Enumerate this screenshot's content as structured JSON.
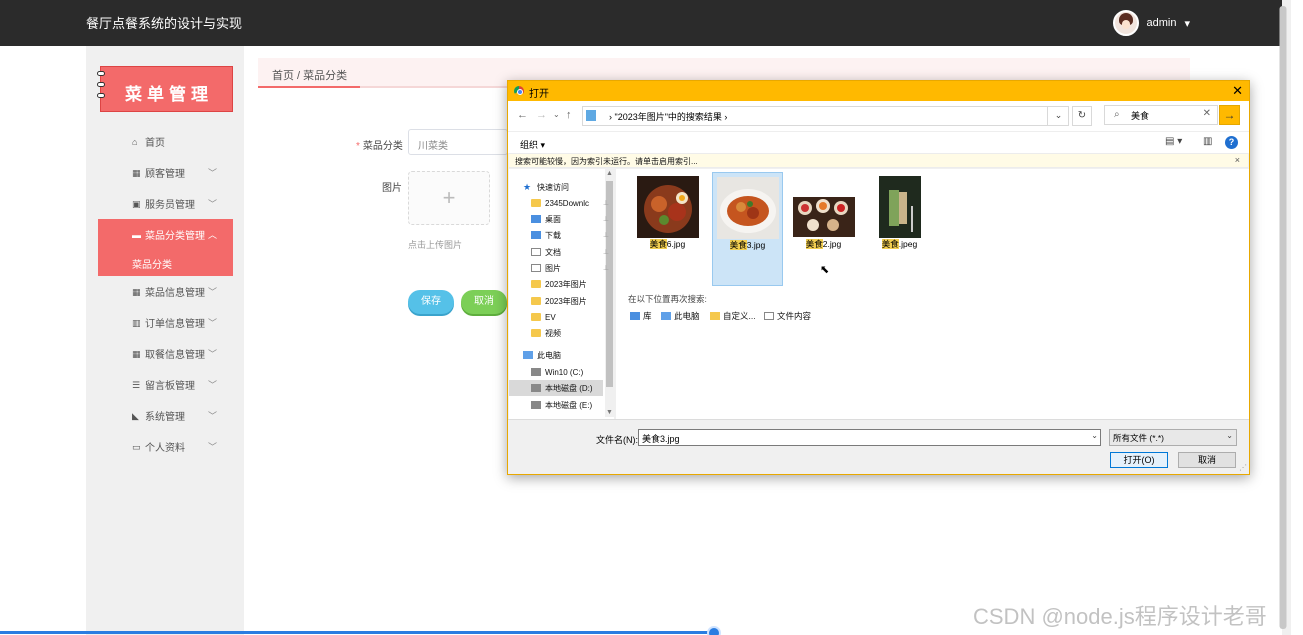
{
  "header": {
    "title": "餐厅点餐系统的设计与实现",
    "user": "admin",
    "caret": "▾"
  },
  "sidebar": {
    "logo": "菜单管理",
    "items": [
      {
        "label": "首页",
        "icon": "⌂",
        "chev": ""
      },
      {
        "label": "顾客管理",
        "icon": "▦",
        "chev": "﹀"
      },
      {
        "label": "服务员管理",
        "icon": "▣",
        "chev": "﹀"
      },
      {
        "label": "菜品分类管理",
        "icon": "▬",
        "chev": "︿"
      },
      {
        "label": "菜品信息管理",
        "icon": "▦",
        "chev": "﹀"
      },
      {
        "label": "订单信息管理",
        "icon": "▥",
        "chev": "﹀"
      },
      {
        "label": "取餐信息管理",
        "icon": "▦",
        "chev": "﹀"
      },
      {
        "label": "留言板管理",
        "icon": "☰",
        "chev": "﹀"
      },
      {
        "label": "系统管理",
        "icon": "◣",
        "chev": "﹀"
      },
      {
        "label": "个人资料",
        "icon": "▭",
        "chev": "﹀"
      }
    ],
    "active_sub": "菜品分类"
  },
  "breadcrumb": "首页 / 菜品分类",
  "form": {
    "category_label": "菜品分类",
    "category_value": "川菜类",
    "image_label": "图片",
    "upload_plus": "+",
    "upload_hint": "点击上传图片",
    "save": "保存",
    "cancel": "取消"
  },
  "dialog": {
    "title": "打开",
    "close": "✕",
    "nav": {
      "back": "←",
      "forward": "→",
      "recent": "⌄",
      "up": "↑"
    },
    "path": "› \"2023年图片\"中的搜索结果 ›",
    "path_dd": "⌄",
    "refresh": "↻",
    "search_icon": "⌕",
    "search_value": "美食",
    "search_clear": "✕",
    "go": "→",
    "organize": "组织 ▾",
    "view_icon": "▤ ▾",
    "pane_icon": "▥",
    "help": "?",
    "info": "搜索可能较慢，因为索引未运行。请单击启用索引...",
    "info_close": "×",
    "nav_items": [
      {
        "label": "快速访问",
        "type": "star",
        "pin": ""
      },
      {
        "label": "2345Downlc",
        "type": "folder",
        "pin": "📌"
      },
      {
        "label": "桌面",
        "type": "blue",
        "pin": "📌"
      },
      {
        "label": "下载",
        "type": "blue",
        "pin": "📌"
      },
      {
        "label": "文档",
        "type": "doc",
        "pin": "📌"
      },
      {
        "label": "图片",
        "type": "doc",
        "pin": "📌"
      },
      {
        "label": "2023年图片",
        "type": "folder",
        "pin": ""
      },
      {
        "label": "2023年图片",
        "type": "folder",
        "pin": ""
      },
      {
        "label": "EV",
        "type": "folder",
        "pin": ""
      },
      {
        "label": "视频",
        "type": "folder",
        "pin": ""
      },
      {
        "label": "此电脑",
        "type": "pc",
        "pin": ""
      },
      {
        "label": "Win10 (C:)",
        "type": "drive",
        "pin": ""
      },
      {
        "label": "本地磁盘 (D:)",
        "type": "drive",
        "pin": ""
      },
      {
        "label": "本地磁盘 (E:)",
        "type": "drive",
        "pin": ""
      }
    ],
    "files": [
      {
        "hl": "美食",
        "rest": "6.jpg"
      },
      {
        "hl": "美食",
        "rest": "3.jpg"
      },
      {
        "hl": "美食",
        "rest": "2.jpg"
      },
      {
        "hl": "美食",
        "rest": ".jpeg"
      }
    ],
    "search_again": "在以下位置再次搜索:",
    "locations": [
      "库",
      "此电脑",
      "自定义...",
      "文件内容"
    ],
    "filename_label": "文件名(N):",
    "filename_value": "美食3.jpg",
    "filetype_value": "所有文件 (*.*)",
    "open": "打开(O)",
    "cancel": "取消"
  },
  "watermark": "CSDN @node.js程序设计老哥"
}
